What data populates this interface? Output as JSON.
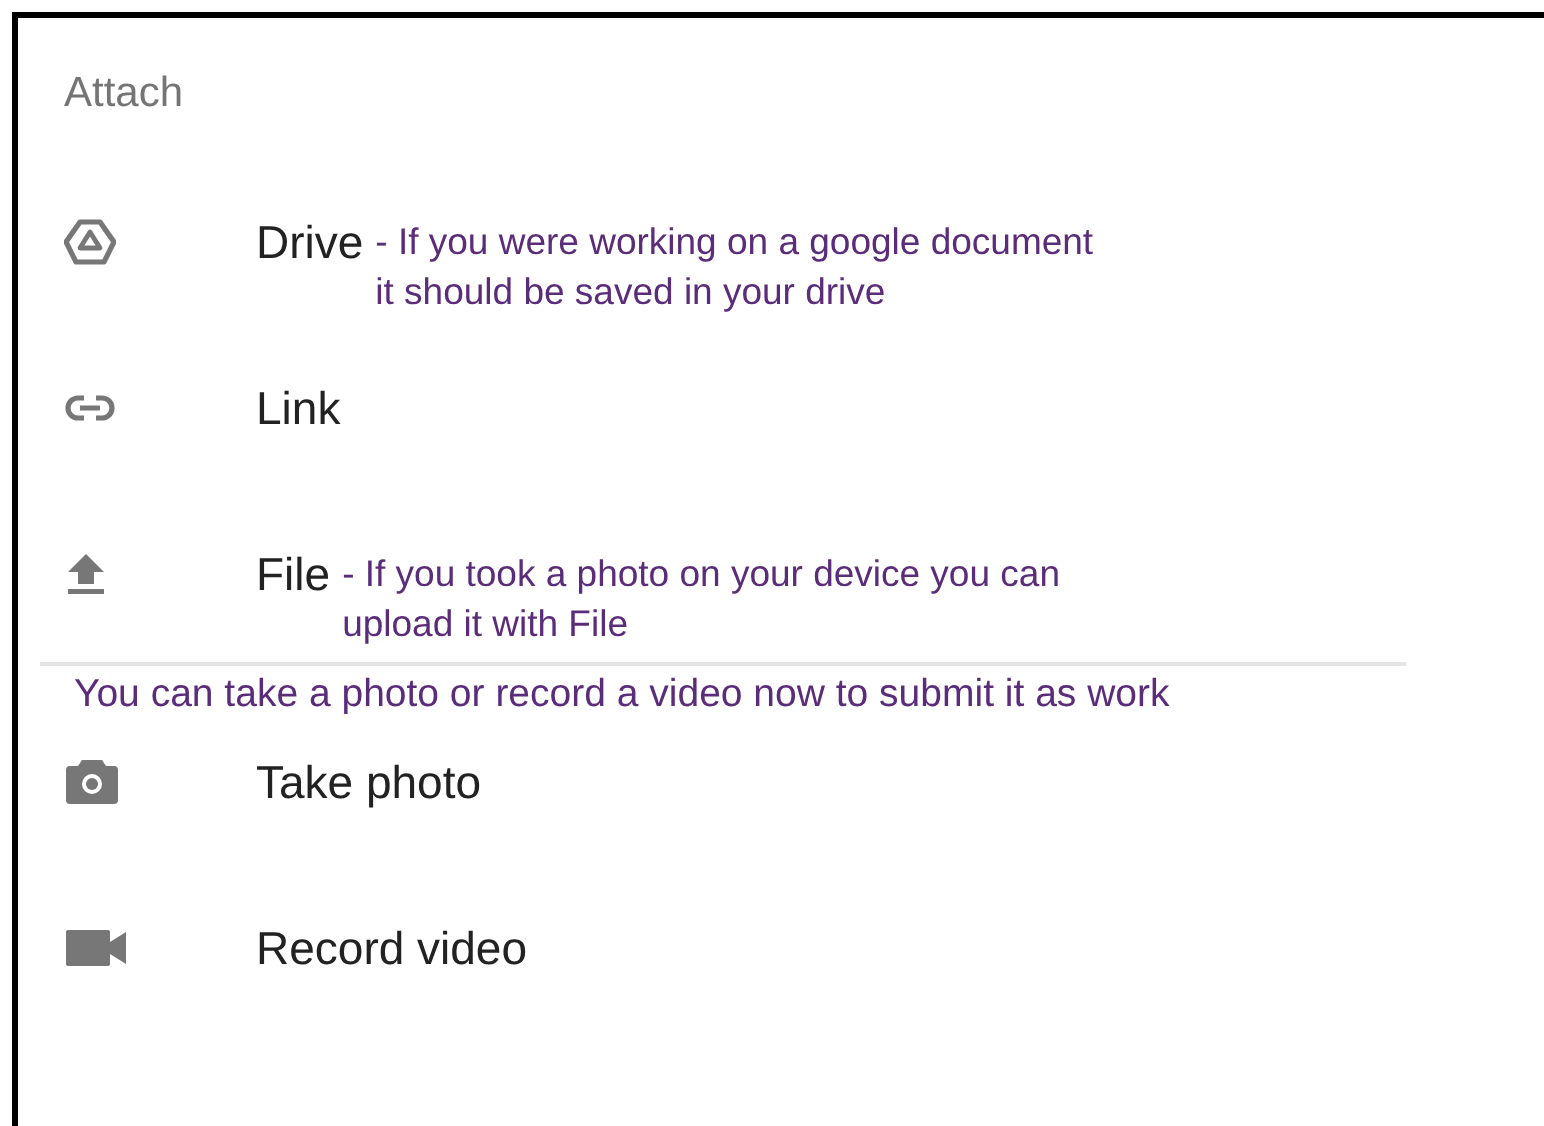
{
  "title": "Attach",
  "items": [
    {
      "kind": "drive",
      "label": "Drive",
      "note": "- If you were working on a google document\nit should be saved in your drive"
    },
    {
      "kind": "link",
      "label": "Link"
    },
    {
      "kind": "file",
      "label": "File",
      "note": "- If you took a photo on your device you can\nupload it with File"
    },
    {
      "kind": "divider_note",
      "text": "You can take a photo or record a video now to submit it as work"
    },
    {
      "kind": "camera",
      "label": "Take photo"
    },
    {
      "kind": "video",
      "label": "Record video"
    }
  ]
}
